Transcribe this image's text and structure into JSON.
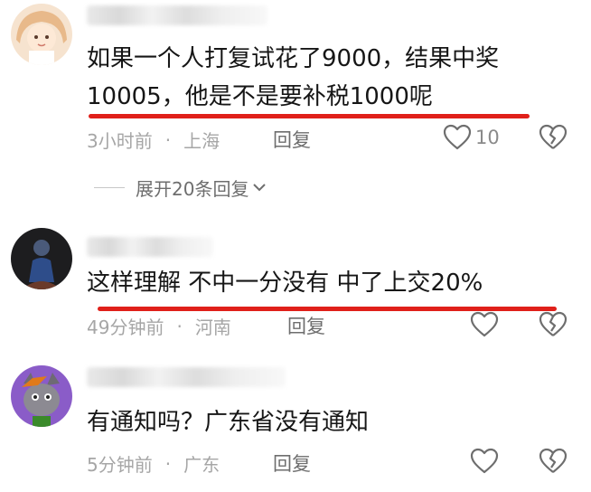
{
  "comments": [
    {
      "text_lines": [
        "如果一个人打复试花了9000，结果中奖",
        "10005，他是不是要补税1000呢"
      ],
      "time": "3小时前",
      "location": "上海",
      "reply_label": "回复",
      "like_count": "10",
      "expand_label": "展开20条回复"
    },
    {
      "text_lines": [
        "这样理解 不中一分没有 中了上交20%"
      ],
      "time": "49分钟前",
      "location": "河南",
      "reply_label": "回复"
    },
    {
      "text_lines": [
        "有通知吗？广东省没有通知"
      ],
      "time": "5分钟前",
      "location": "广东",
      "reply_label": "回复"
    }
  ],
  "separator": "·",
  "icons": {
    "like": "heart-outline-icon",
    "dislike": "broken-heart-icon",
    "expand": "chevron-down-icon"
  },
  "colors": {
    "highlight_line": "#e0201a",
    "meta_text": "#a6a6a6",
    "reply_text": "#6e6e6e"
  }
}
